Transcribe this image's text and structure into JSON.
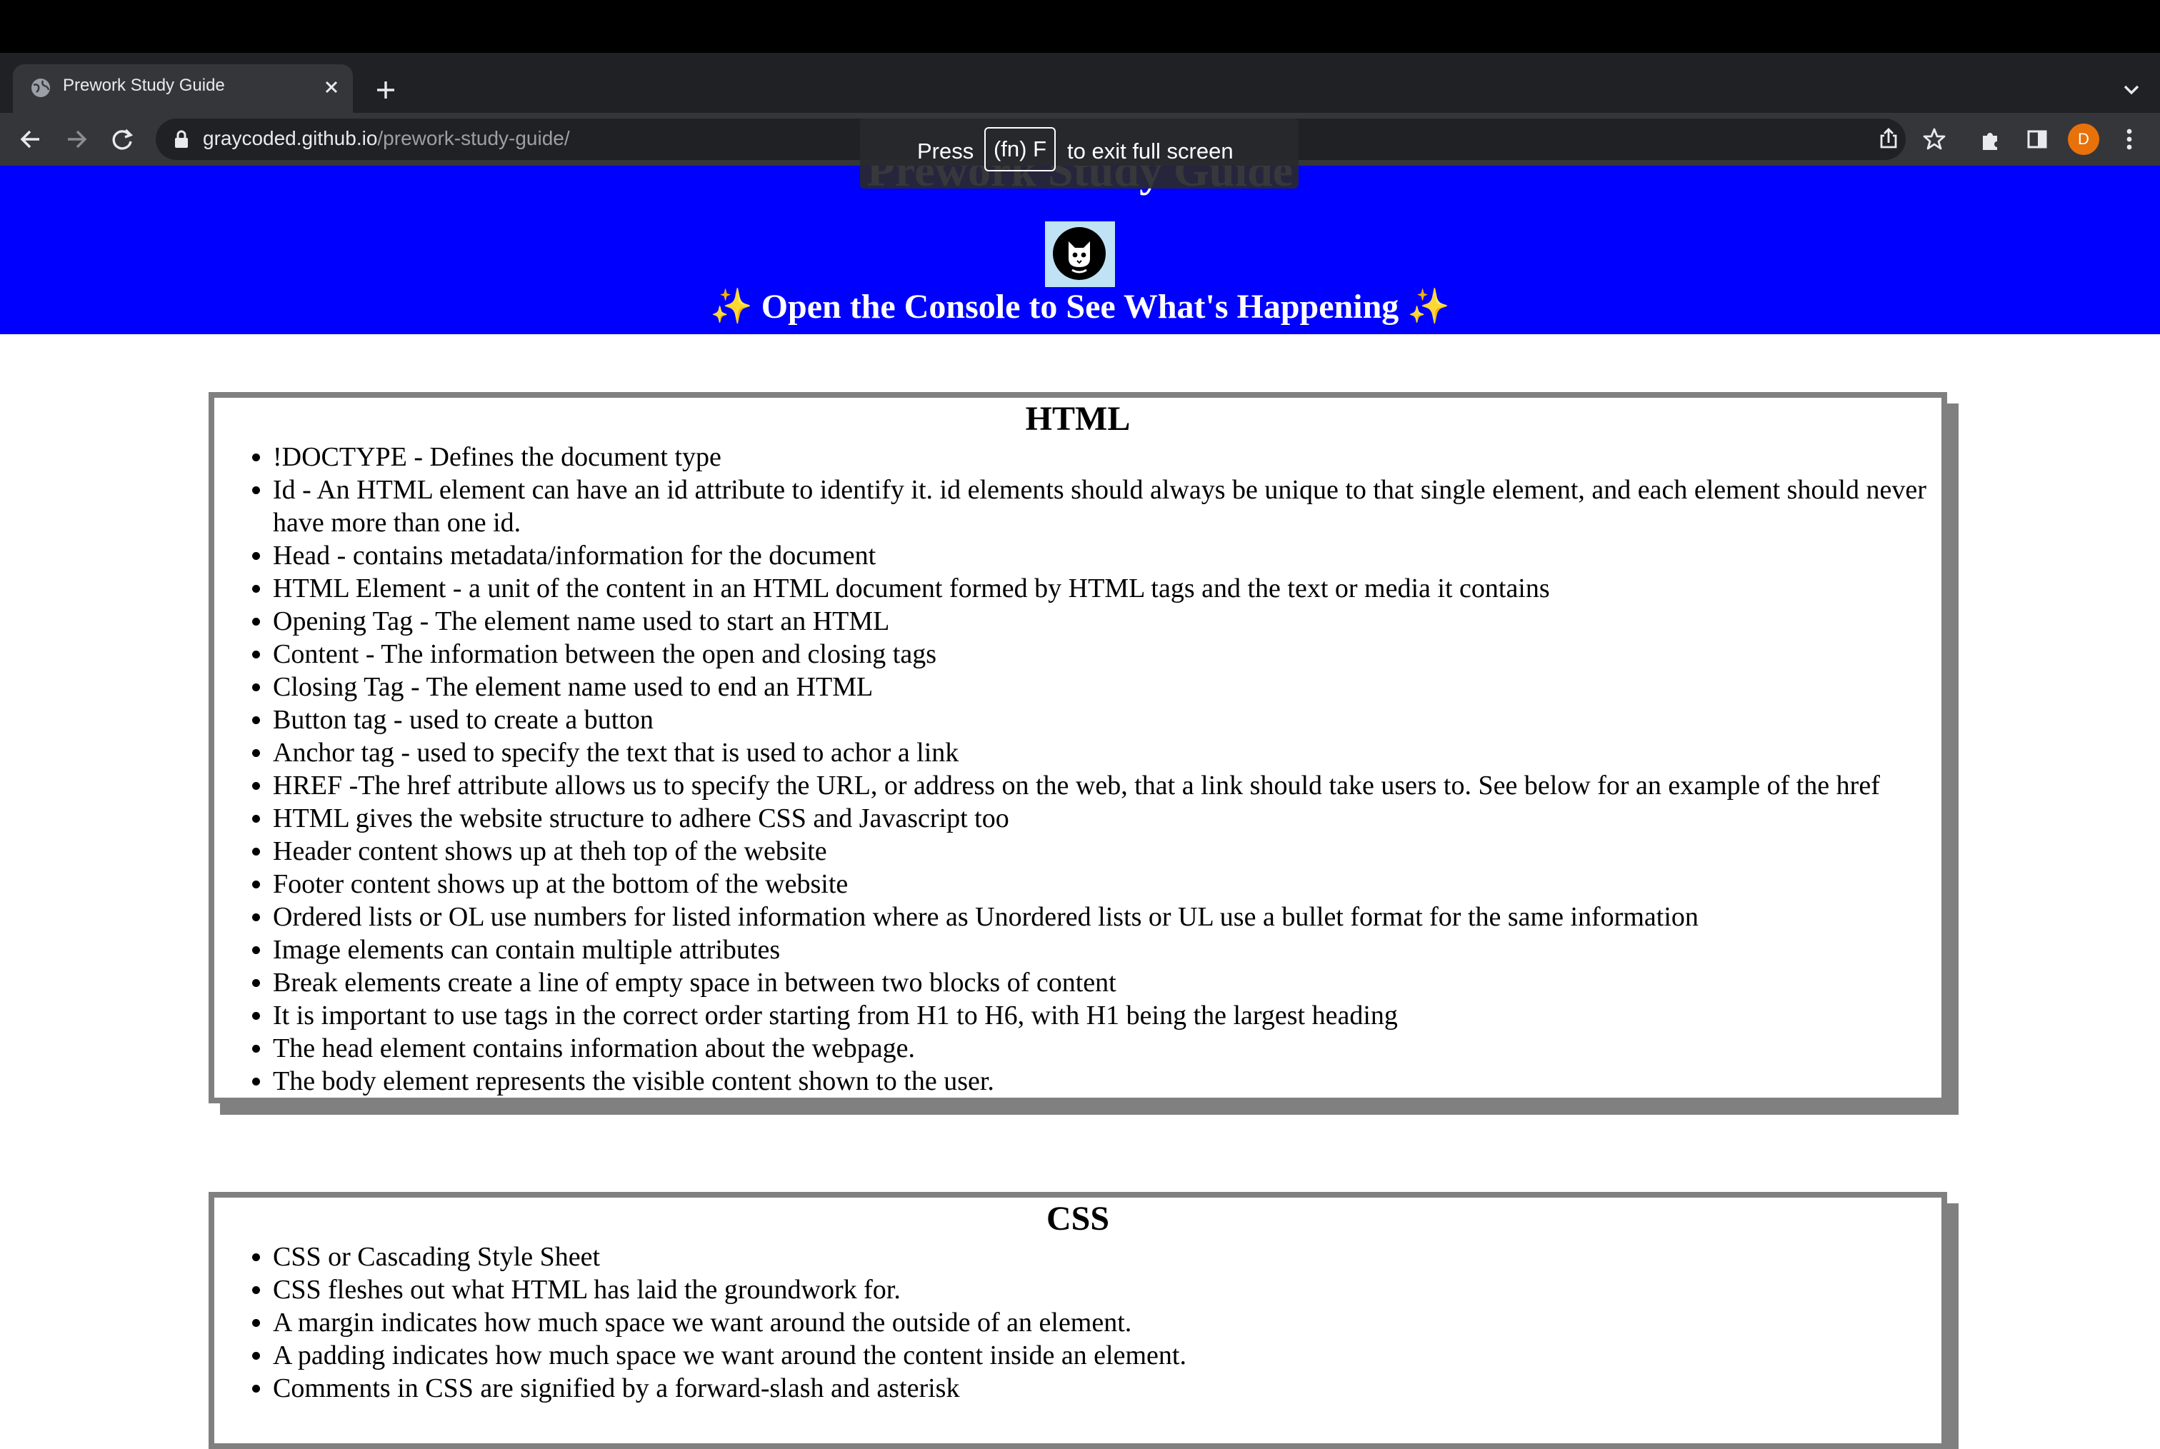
{
  "browser": {
    "tab_title": "Prework Study Guide",
    "url_host": "graycoded.github.io",
    "url_path": "/prework-study-guide/",
    "profile_initial": "D",
    "accent_color": "#e8710a"
  },
  "fullscreen_notice": {
    "press": "Press",
    "key": "(fn) F",
    "rest": "to exit full screen"
  },
  "header": {
    "title": "Prework Study Guide",
    "tagline": "Open the Console to See What's Happening",
    "sparkle": "✨",
    "background_color": "#0000ff"
  },
  "sections": {
    "html": {
      "title": "HTML",
      "items": [
        "!DOCTYPE - Defines the document type",
        "Id - An HTML element can have an id attribute to identify it. id elements should always be unique to that single element, and each element should never have more than one id.",
        "Head - contains metadata/information for the document",
        "HTML Element - a unit of the content in an HTML document formed by HTML tags and the text or media it contains",
        "Opening Tag - The element name used to start an HTML",
        "Content - The information between the open and closing tags",
        "Closing Tag - The element name used to end an HTML",
        "Button tag - used to create a button",
        "Anchor tag - used to specify the text that is used to achor a link",
        "HREF -The href attribute allows us to specify the URL, or address on the web, that a link should take users to. See below for an example of the href",
        "HTML gives the website structure to adhere CSS and Javascript too",
        "Header content shows up at theh top of the website",
        "Footer content shows up at the bottom of the website",
        "Ordered lists or OL use numbers for listed information where as Unordered lists or UL use a bullet format for the same information",
        "Image elements can contain multiple attributes",
        "Break elements create a line of empty space in between two blocks of content",
        "It is important to use tags in the correct order starting from H1 to H6, with H1 being the largest heading",
        "The head element contains information about the webpage.",
        "The body element represents the visible content shown to the user."
      ]
    },
    "css": {
      "title": "CSS",
      "items": [
        "CSS or Cascading Style Sheet",
        "CSS fleshes out what HTML has laid the groundwork for.",
        "A margin indicates how much space we want around the outside of an element.",
        "A padding indicates how much space we want around the content inside an element.",
        "Comments in CSS are signified by a forward-slash and asterisk"
      ]
    }
  }
}
